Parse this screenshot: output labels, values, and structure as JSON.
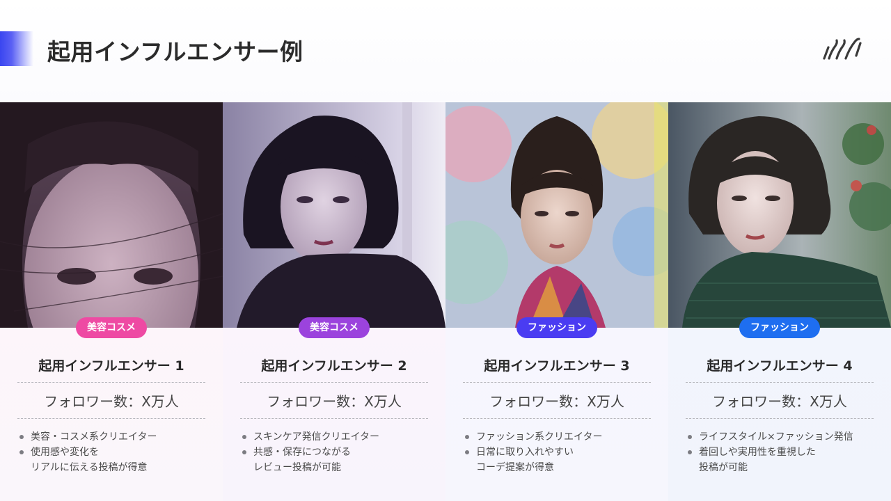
{
  "page": {
    "title": "起用インフルエンサー例"
  },
  "cards": [
    {
      "tag": "美容コスメ",
      "name": "起用インフルエンサー 1",
      "followers": "フォロワー数：X万人",
      "bullets": [
        "美容・コスメ系クリエイター",
        "使用感や変化を\nリアルに伝える投稿が得意"
      ],
      "tag_color": "#ee4aa3"
    },
    {
      "tag": "美容コスメ",
      "name": "起用インフルエンサー 2",
      "followers": "フォロワー数：X万人",
      "bullets": [
        "スキンケア発信クリエイター",
        "共感・保存につながる\nレビュー投稿が可能"
      ],
      "tag_color": "#9b43dd"
    },
    {
      "tag": "ファッション",
      "name": "起用インフルエンサー 3",
      "followers": "フォロワー数：X万人",
      "bullets": [
        "ファッション系クリエイター",
        "日常に取り入れやすい\nコーデ提案が得意"
      ],
      "tag_color": "#4a3cf2"
    },
    {
      "tag": "ファッション",
      "name": "起用インフルエンサー 4",
      "followers": "フォロワー数：X万人",
      "bullets": [
        "ライフスタイル×ファッション発信",
        "着回しや実用性を重視した\n投稿が可能"
      ],
      "tag_color": "#1e6ef0"
    }
  ],
  "icons": {
    "logo": "brand-logo-icon",
    "bullet": "bullet-dot-icon",
    "photos": [
      "portrait-photo-icon",
      "portrait-photo-icon",
      "portrait-photo-icon",
      "portrait-photo-icon"
    ]
  },
  "colors": {
    "accent": "#3a46f0",
    "title": "#2b2b2b"
  }
}
